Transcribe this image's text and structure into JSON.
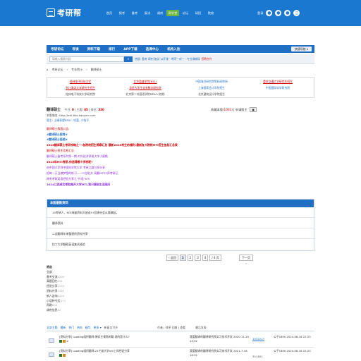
{
  "header": {
    "logo_text": "考研帮",
    "nav": [
      "首页",
      "报考",
      "备考",
      "复试",
      "调剂",
      "帮学堂",
      "论坛",
      "研招",
      "院校"
    ],
    "active_nav_index": 5,
    "login": "登录",
    "colors": {
      "bar": "#1a78d0",
      "active": "#6db33f"
    }
  },
  "forumbar": {
    "items": [
      "考研论坛",
      "导读",
      "资料下载",
      "排行",
      "APP下载",
      "选课中心",
      "机构入驻"
    ],
    "quick": "快捷导航 ▾"
  },
  "search": {
    "placeholder": "请输入搜索内容",
    "button_icon": "search-icon",
    "hot_label": "热搜:",
    "hot_words": "备考 调剂 复试 公开课 · 考研一对一 · 专业课辅导",
    "hot_highlight": "招聘合作"
  },
  "breadcrumb": [
    "考研论坛",
    "专业院士",
    "翻译硕士"
  ],
  "links": {
    "row1": [
      "桂林电子科技大学",
      "北京盈盛学院(831)",
      "中国海洋研究院等科研院所",
      "重庆交通大学研究生招生"
    ],
    "row2": [
      "浙江海洋大学研究生招生",
      "华侨大学生化系数学研究院",
      "上海国家会计学院招生",
      "中国国际科学研究院"
    ],
    "row3": [
      "桂林电子科技大学研究院",
      "北京第二外国语学院MPACC热线",
      "北京建筑设计学院招生"
    ]
  },
  "forum": {
    "name": "翻译硕士",
    "today_label": "今日:",
    "today": "0",
    "topics_label": "主题:",
    "topics": "85",
    "rank_label": "排名:",
    "rank": "330",
    "fav_label": "收藏本版",
    "fav_count": "(1003)",
    "apply": "申请版主",
    "domain_line": "本版域名: http://mti.bbs.kaoyan.com",
    "mod_line": "版主: 土确表望8897, 叽蓬, 小怡子",
    "intro_title": "翻译硕士版面公告:",
    "lines": [
      "#翻译硕士报考#",
      "#翻译硕士经验#",
      "2015翻译硕士考研攻略之一:各院校招生简章汇总       最新2015考生的福利:最新各大院校MTI招生信息汇总表",
      "翻译硕士招生信息汇总",
      "翻译硕士备考系列第一期:对外经济贸易大学小蜜桃",
      "2015年MTI考研,你选择哪个学校呢?",
      "由中国大学到中国科学院大学 考研之路与你分享",
      "把每一天当做梦想的练习——二战北外 高翻MTI口译考研记",
      "跨考考研英语经验分享之“外语”MTI",
      "2014江西成功考取南开大学MTI,我只想说生活阅历"
    ]
  },
  "newest": {
    "title": "本版最新资料",
    "items": [
      "15考研人、MTI海量资料大放送!!!回馈社会从我做起。",
      "翻译资料",
      "二战翻译年来整理的资料共享",
      "拉丁大学翻硕英语复试经验"
    ]
  },
  "pager": {
    "prev": "‹ 返回",
    "pages": [
      "1",
      "2",
      "3",
      "4"
    ],
    "current": "1",
    "goto": "/ 4 页",
    "next": "下一页 ›"
  },
  "categories": {
    "head": "筛选",
    "items": [
      {
        "label": "全部",
        "count": ""
      },
      {
        "label": "备考交流",
        "count": "4309"
      },
      {
        "label": "真题回忆",
        "count": "291"
      },
      {
        "label": "经验分享",
        "count": "2253"
      },
      {
        "label": "资料共享",
        "count": "1567"
      },
      {
        "label": "新人咨询",
        "count": "4259"
      },
      {
        "label": "小语种专区",
        "count": "373"
      },
      {
        "label": "再刷",
        "count": "850"
      },
      {
        "label": "调剂信息",
        "count": "85"
      }
    ]
  },
  "table_tabs": [
    "全部主题",
    "最新",
    "热门",
    "热帖",
    "精华",
    "更多 ▾",
    "新窗口打开",
    "作者 | 排序 回复 | 查看",
    "最后发表"
  ],
  "threads": [
    {
      "title": "[资料分享] Loading组织翻译:博弈主视角闲聊,说的是什么?",
      "page": "2",
      "author": "我爱翻译的翻译研究院实习技术开发 2020-11-25 13:32",
      "replies": "1932513",
      "views": "",
      "last": "公子1890 2024-08-18 22:23"
    },
    {
      "title": "[资料分享] Loading组织翻译:21宁波大学mti上岸经验分享",
      "page": "",
      "author": "我爱翻译的翻译研究院实习技术开发 2021-7-16 16:32",
      "replies": "",
      "views": "341481",
      "last": "公子1890 2024-08-18 22:23"
    }
  ]
}
